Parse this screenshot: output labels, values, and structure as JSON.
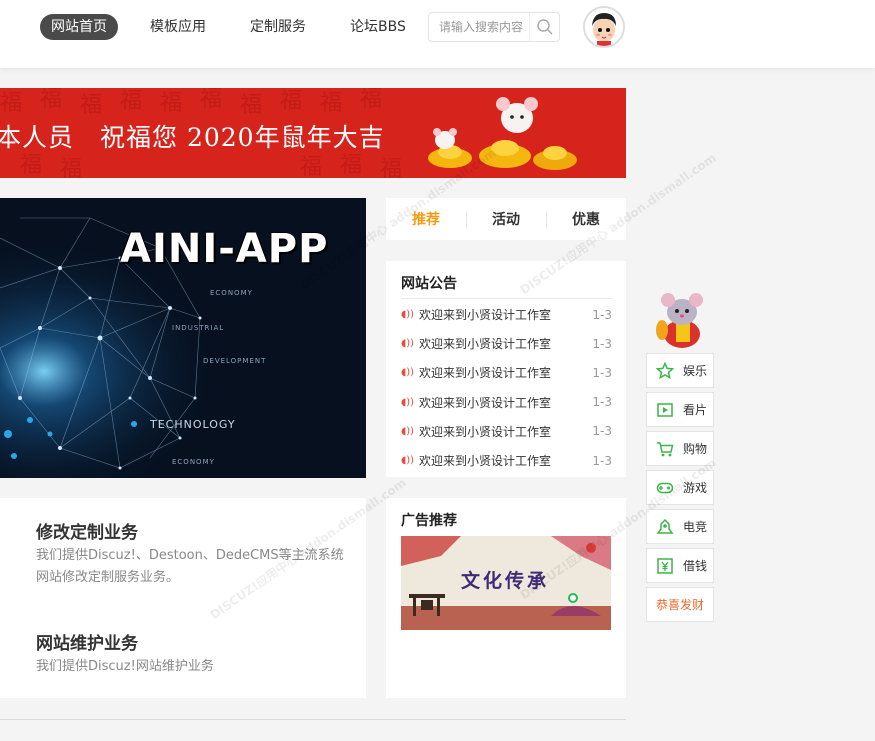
{
  "nav": {
    "items": [
      {
        "label": "网站首页",
        "active": true
      },
      {
        "label": "模板应用",
        "active": false
      },
      {
        "label": "定制服务",
        "active": false
      },
      {
        "label": "论坛BBS",
        "active": false
      }
    ]
  },
  "search": {
    "placeholder": "请输入搜索内容",
    "icon": "search-icon"
  },
  "banner": {
    "text": "本人员　祝福您 2020年鼠年大吉",
    "bg": "#d6241c"
  },
  "hero": {
    "title": "AINI-APP",
    "words": [
      "ECONOMY",
      "INDUSTRIAL",
      "DEVELOPMENT",
      "TECHNOLOGY",
      "ECONOMY"
    ]
  },
  "tabs": {
    "items": [
      {
        "label": "推荐",
        "active": true
      },
      {
        "label": "活动",
        "active": false
      },
      {
        "label": "优惠",
        "active": false
      }
    ],
    "accent": "#f39c12"
  },
  "notice": {
    "title": "网站公告",
    "items": [
      {
        "text": "欢迎来到小贤设计工作室",
        "date": "1-3"
      },
      {
        "text": "欢迎来到小贤设计工作室",
        "date": "1-3"
      },
      {
        "text": "欢迎来到小贤设计工作室",
        "date": "1-3"
      },
      {
        "text": "欢迎来到小贤设计工作室",
        "date": "1-3"
      },
      {
        "text": "欢迎来到小贤设计工作室",
        "date": "1-3"
      },
      {
        "text": "欢迎来到小贤设计工作室",
        "date": "1-3"
      }
    ]
  },
  "services": [
    {
      "title": "修改定制业务",
      "desc": "我们提供Discuz!、Destoon、DedeCMS等主流系统网站修改定制服务业务。"
    },
    {
      "title": "网站维护业务",
      "desc": "我们提供Discuz!网站维护业务"
    }
  ],
  "ads": {
    "title": "广告推荐",
    "image_text": "文化传承"
  },
  "side": {
    "items": [
      {
        "label": "娱乐",
        "icon": "star-icon"
      },
      {
        "label": "看片",
        "icon": "play-icon"
      },
      {
        "label": "购物",
        "icon": "cart-icon"
      },
      {
        "label": "游戏",
        "icon": "gamepad-icon"
      },
      {
        "label": "电竞",
        "icon": "esports-icon"
      },
      {
        "label": "借钱",
        "icon": "yen-icon"
      }
    ],
    "greeting": "恭喜发财",
    "icon_color": "#3bb54a"
  },
  "watermark": "DISCUZ!应用中心 addon.dismall.com"
}
